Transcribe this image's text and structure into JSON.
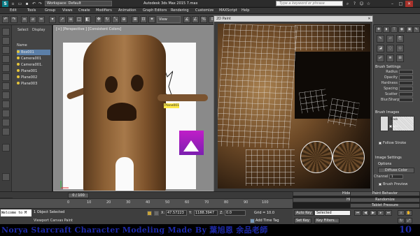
{
  "titlebar": {
    "workspace": "Workspace: Default",
    "window_title": "Autodesk 3ds Max 2015    7.max",
    "search_placeholder": "Type a keyword or phrase"
  },
  "menu": [
    "Edit",
    "Tools",
    "Group",
    "Views",
    "Create",
    "Modifiers",
    "Animation",
    "Graph Editors",
    "Rendering",
    "Customize",
    "MAXScript",
    "Help"
  ],
  "toolbar": {
    "view_dropdown": "View"
  },
  "explorer": {
    "tabs": [
      "Select",
      "Display"
    ],
    "header": "Name",
    "items": [
      "Box001",
      "Camera001",
      "Camera001.",
      "Plane001",
      "Plane002",
      "Plane003"
    ]
  },
  "viewport": {
    "label": "[+] [Perspective ] [Consistent Colors]",
    "plane_tag": "Plane001"
  },
  "paint": {
    "title": "2D Paint"
  },
  "cmdpanel": {
    "brush_settings": "Brush Settings",
    "params": [
      {
        "label": "Radius",
        "value": ""
      },
      {
        "label": "Opacity",
        "value": ""
      },
      {
        "label": "Hardness",
        "value": ""
      },
      {
        "label": "Spacing",
        "value": ""
      },
      {
        "label": "Scatter",
        "value": ""
      },
      {
        "label": "Blur/Sharpen",
        "value": ""
      }
    ],
    "brush_images": "Brush Images",
    "mask_label": "Mask",
    "use_label": "Use",
    "follow_stroke": "Follow Stroke",
    "image_settings": "Image Settings",
    "options": "Options",
    "diffuse_color": "Diffuse Color",
    "channel_label": "Channel",
    "channel_value": "1",
    "brush_preview": "Brush Preview"
  },
  "rollouts": [
    "Hide by Name...",
    "Hide by Hit",
    "Paint Behavior",
    "Randomize",
    "Tablet Pressure"
  ],
  "timeline": {
    "slider": "0 / 100",
    "ticks": [
      "0",
      "10",
      "20",
      "30",
      "40",
      "50",
      "60",
      "70",
      "80",
      "90",
      "100"
    ]
  },
  "status": {
    "script_text": "Welcome to M",
    "selected_text": "1 Object Selected",
    "prompt": "Viewport Canvas Paint",
    "x_label": "X:",
    "x_value": "47.57223",
    "y_label": "Y:",
    "y_value": "1188.3947",
    "z_label": "Z:",
    "z_value": "0.0",
    "grid": "Grid = 10.0",
    "add_time_tag": "Add Time Tag"
  },
  "autokey": {
    "auto_key": "Auto Key",
    "set_key": "Set Key",
    "dropdown": "Selected",
    "key_filters": "Key Filters..."
  },
  "caption": {
    "text": "Norya Starcraft Character Modeling Made By 葉旭恩 余品老師",
    "number": "10"
  }
}
